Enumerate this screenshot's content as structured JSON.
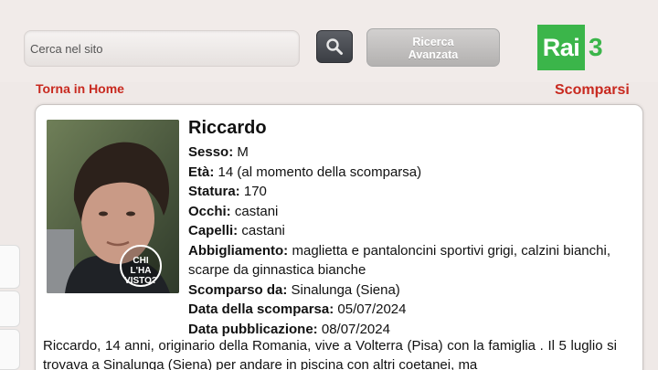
{
  "header": {
    "search": {
      "placeholder": "Cerca nel sito"
    },
    "advanced_search": {
      "line1": "Ricerca",
      "line2": "Avanzata"
    },
    "logo": {
      "text": "Rai",
      "number": "3",
      "color": "#3bb54a"
    }
  },
  "nav": {
    "home_link": "Torna in Home",
    "section": "Scomparsi",
    "accent_color": "#c8291f"
  },
  "person": {
    "name": "Riccardo",
    "photo_watermark": "CHI L'HA VISTO?",
    "fields": [
      {
        "label": "Sesso:",
        "value": "M"
      },
      {
        "label": "Età:",
        "value": "14 (al momento della scomparsa)"
      },
      {
        "label": "Statura:",
        "value": "170"
      },
      {
        "label": "Occhi:",
        "value": "castani"
      },
      {
        "label": "Capelli:",
        "value": "castani"
      },
      {
        "label": "Abbigliamento:",
        "value": "maglietta e pantaloncini sportivi grigi, calzini bianchi, scarpe da ginnastica bianche"
      },
      {
        "label": "Scomparso da:",
        "value": "Sinalunga (Siena)"
      },
      {
        "label": "Data della scomparsa:",
        "value": "05/07/2024"
      },
      {
        "label": "Data pubblicazione:",
        "value": "08/07/2024"
      }
    ],
    "description": "Riccardo, 14 anni, originario della Romania, vive a Volterra (Pisa) con la famiglia . Il 5 luglio si trovava a Sinalunga (Siena) per andare in piscina con altri coetanei, ma"
  },
  "icons": {
    "search": "search-icon"
  }
}
